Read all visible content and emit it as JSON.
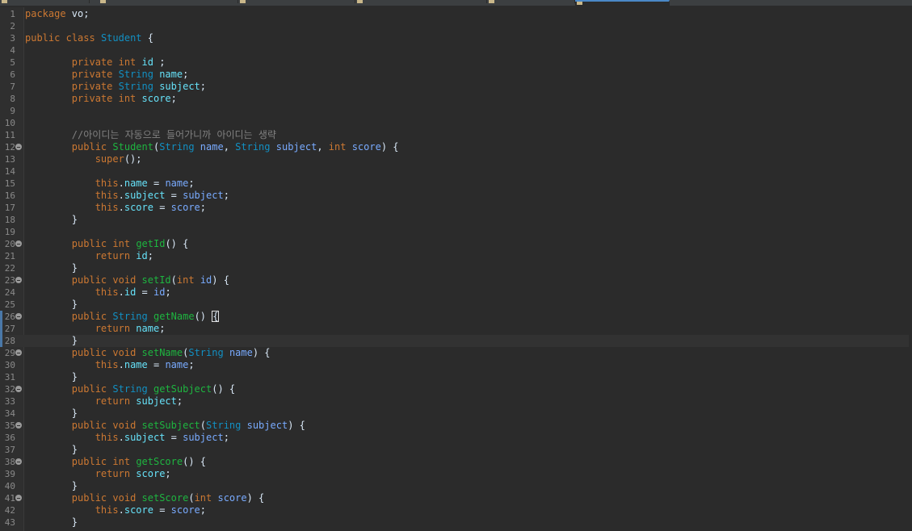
{
  "editor": {
    "current_line": 28,
    "lines": [
      {
        "no": "1",
        "fold": false,
        "tokens": [
          {
            "t": "package",
            "c": "kw"
          },
          {
            "t": " vo;",
            "c": "pl"
          }
        ]
      },
      {
        "no": "2",
        "fold": false,
        "tokens": []
      },
      {
        "no": "3",
        "fold": false,
        "tokens": [
          {
            "t": "public",
            "c": "kw"
          },
          {
            "t": " ",
            "c": "pl"
          },
          {
            "t": "class",
            "c": "kw"
          },
          {
            "t": " ",
            "c": "pl"
          },
          {
            "t": "Student",
            "c": "ty"
          },
          {
            "t": " {",
            "c": "pl"
          }
        ]
      },
      {
        "no": "4",
        "fold": false,
        "tokens": []
      },
      {
        "no": "5",
        "fold": false,
        "tokens": [
          {
            "t": "        ",
            "c": "pl"
          },
          {
            "t": "private",
            "c": "kw"
          },
          {
            "t": " ",
            "c": "pl"
          },
          {
            "t": "int",
            "c": "kw"
          },
          {
            "t": " ",
            "c": "pl"
          },
          {
            "t": "id",
            "c": "fld"
          },
          {
            "t": " ;",
            "c": "pl"
          }
        ]
      },
      {
        "no": "6",
        "fold": false,
        "tokens": [
          {
            "t": "        ",
            "c": "pl"
          },
          {
            "t": "private",
            "c": "kw"
          },
          {
            "t": " ",
            "c": "pl"
          },
          {
            "t": "String",
            "c": "ty"
          },
          {
            "t": " ",
            "c": "pl"
          },
          {
            "t": "name",
            "c": "fld"
          },
          {
            "t": ";",
            "c": "pl"
          }
        ]
      },
      {
        "no": "7",
        "fold": false,
        "tokens": [
          {
            "t": "        ",
            "c": "pl"
          },
          {
            "t": "private",
            "c": "kw"
          },
          {
            "t": " ",
            "c": "pl"
          },
          {
            "t": "String",
            "c": "ty"
          },
          {
            "t": " ",
            "c": "pl"
          },
          {
            "t": "subject",
            "c": "fld"
          },
          {
            "t": ";",
            "c": "pl"
          }
        ]
      },
      {
        "no": "8",
        "fold": false,
        "tokens": [
          {
            "t": "        ",
            "c": "pl"
          },
          {
            "t": "private",
            "c": "kw"
          },
          {
            "t": " ",
            "c": "pl"
          },
          {
            "t": "int",
            "c": "kw"
          },
          {
            "t": " ",
            "c": "pl"
          },
          {
            "t": "score",
            "c": "fld"
          },
          {
            "t": ";",
            "c": "pl"
          }
        ]
      },
      {
        "no": "9",
        "fold": false,
        "tokens": []
      },
      {
        "no": "10",
        "fold": false,
        "tokens": []
      },
      {
        "no": "11",
        "fold": false,
        "tokens": [
          {
            "t": "        ",
            "c": "pl"
          },
          {
            "t": "//아이디는 자동으로 들어가니까 아이디는 생략",
            "c": "cm"
          }
        ]
      },
      {
        "no": "12",
        "fold": true,
        "tokens": [
          {
            "t": "        ",
            "c": "pl"
          },
          {
            "t": "public",
            "c": "kw"
          },
          {
            "t": " ",
            "c": "pl"
          },
          {
            "t": "Student",
            "c": "fn"
          },
          {
            "t": "(",
            "c": "pl"
          },
          {
            "t": "String",
            "c": "ty"
          },
          {
            "t": " ",
            "c": "pl"
          },
          {
            "t": "name",
            "c": "var"
          },
          {
            "t": ", ",
            "c": "pl"
          },
          {
            "t": "String",
            "c": "ty"
          },
          {
            "t": " ",
            "c": "pl"
          },
          {
            "t": "subject",
            "c": "var"
          },
          {
            "t": ", ",
            "c": "pl"
          },
          {
            "t": "int",
            "c": "kw"
          },
          {
            "t": " ",
            "c": "pl"
          },
          {
            "t": "score",
            "c": "var"
          },
          {
            "t": ") {",
            "c": "pl"
          }
        ]
      },
      {
        "no": "13",
        "fold": false,
        "tokens": [
          {
            "t": "            ",
            "c": "pl"
          },
          {
            "t": "super",
            "c": "kw"
          },
          {
            "t": "();",
            "c": "pl"
          }
        ]
      },
      {
        "no": "14",
        "fold": false,
        "tokens": []
      },
      {
        "no": "15",
        "fold": false,
        "tokens": [
          {
            "t": "            ",
            "c": "pl"
          },
          {
            "t": "this",
            "c": "kw"
          },
          {
            "t": ".",
            "c": "pl"
          },
          {
            "t": "name",
            "c": "fld"
          },
          {
            "t": " = ",
            "c": "pl"
          },
          {
            "t": "name",
            "c": "var"
          },
          {
            "t": ";",
            "c": "pl"
          }
        ]
      },
      {
        "no": "16",
        "fold": false,
        "tokens": [
          {
            "t": "            ",
            "c": "pl"
          },
          {
            "t": "this",
            "c": "kw"
          },
          {
            "t": ".",
            "c": "pl"
          },
          {
            "t": "subject",
            "c": "fld"
          },
          {
            "t": " = ",
            "c": "pl"
          },
          {
            "t": "subject",
            "c": "var"
          },
          {
            "t": ";",
            "c": "pl"
          }
        ]
      },
      {
        "no": "17",
        "fold": false,
        "tokens": [
          {
            "t": "            ",
            "c": "pl"
          },
          {
            "t": "this",
            "c": "kw"
          },
          {
            "t": ".",
            "c": "pl"
          },
          {
            "t": "score",
            "c": "fld"
          },
          {
            "t": " = ",
            "c": "pl"
          },
          {
            "t": "score",
            "c": "var"
          },
          {
            "t": ";",
            "c": "pl"
          }
        ]
      },
      {
        "no": "18",
        "fold": false,
        "tokens": [
          {
            "t": "        }",
            "c": "pl"
          }
        ]
      },
      {
        "no": "19",
        "fold": false,
        "tokens": []
      },
      {
        "no": "20",
        "fold": true,
        "tokens": [
          {
            "t": "        ",
            "c": "pl"
          },
          {
            "t": "public",
            "c": "kw"
          },
          {
            "t": " ",
            "c": "pl"
          },
          {
            "t": "int",
            "c": "kw"
          },
          {
            "t": " ",
            "c": "pl"
          },
          {
            "t": "getId",
            "c": "fn"
          },
          {
            "t": "() {",
            "c": "pl"
          }
        ]
      },
      {
        "no": "21",
        "fold": false,
        "tokens": [
          {
            "t": "            ",
            "c": "pl"
          },
          {
            "t": "return",
            "c": "kw"
          },
          {
            "t": " ",
            "c": "pl"
          },
          {
            "t": "id",
            "c": "fld"
          },
          {
            "t": ";",
            "c": "pl"
          }
        ]
      },
      {
        "no": "22",
        "fold": false,
        "tokens": [
          {
            "t": "        }",
            "c": "pl"
          }
        ]
      },
      {
        "no": "23",
        "fold": true,
        "tokens": [
          {
            "t": "        ",
            "c": "pl"
          },
          {
            "t": "public",
            "c": "kw"
          },
          {
            "t": " ",
            "c": "pl"
          },
          {
            "t": "void",
            "c": "kw"
          },
          {
            "t": " ",
            "c": "pl"
          },
          {
            "t": "setId",
            "c": "fn"
          },
          {
            "t": "(",
            "c": "pl"
          },
          {
            "t": "int",
            "c": "kw"
          },
          {
            "t": " ",
            "c": "pl"
          },
          {
            "t": "id",
            "c": "var"
          },
          {
            "t": ") {",
            "c": "pl"
          }
        ]
      },
      {
        "no": "24",
        "fold": false,
        "tokens": [
          {
            "t": "            ",
            "c": "pl"
          },
          {
            "t": "this",
            "c": "kw"
          },
          {
            "t": ".",
            "c": "pl"
          },
          {
            "t": "id",
            "c": "fld"
          },
          {
            "t": " = ",
            "c": "pl"
          },
          {
            "t": "id",
            "c": "var"
          },
          {
            "t": ";",
            "c": "pl"
          }
        ]
      },
      {
        "no": "25",
        "fold": false,
        "tokens": [
          {
            "t": "        }",
            "c": "pl"
          }
        ]
      },
      {
        "no": "26",
        "fold": true,
        "tokens": [
          {
            "t": "        ",
            "c": "pl"
          },
          {
            "t": "public",
            "c": "kw"
          },
          {
            "t": " ",
            "c": "pl"
          },
          {
            "t": "String",
            "c": "ty"
          },
          {
            "t": " ",
            "c": "pl"
          },
          {
            "t": "getName",
            "c": "fn"
          },
          {
            "t": "() ",
            "c": "pl"
          },
          {
            "t": "{",
            "c": "caret"
          }
        ]
      },
      {
        "no": "27",
        "fold": false,
        "tokens": [
          {
            "t": "            ",
            "c": "pl"
          },
          {
            "t": "return",
            "c": "kw"
          },
          {
            "t": " ",
            "c": "pl"
          },
          {
            "t": "name",
            "c": "fld"
          },
          {
            "t": ";",
            "c": "pl"
          }
        ]
      },
      {
        "no": "28",
        "fold": false,
        "tokens": [
          {
            "t": "        }",
            "c": "pl"
          }
        ]
      },
      {
        "no": "29",
        "fold": true,
        "tokens": [
          {
            "t": "        ",
            "c": "pl"
          },
          {
            "t": "public",
            "c": "kw"
          },
          {
            "t": " ",
            "c": "pl"
          },
          {
            "t": "void",
            "c": "kw"
          },
          {
            "t": " ",
            "c": "pl"
          },
          {
            "t": "setName",
            "c": "fn"
          },
          {
            "t": "(",
            "c": "pl"
          },
          {
            "t": "String",
            "c": "ty"
          },
          {
            "t": " ",
            "c": "pl"
          },
          {
            "t": "name",
            "c": "var"
          },
          {
            "t": ") {",
            "c": "pl"
          }
        ]
      },
      {
        "no": "30",
        "fold": false,
        "tokens": [
          {
            "t": "            ",
            "c": "pl"
          },
          {
            "t": "this",
            "c": "kw"
          },
          {
            "t": ".",
            "c": "pl"
          },
          {
            "t": "name",
            "c": "fld"
          },
          {
            "t": " = ",
            "c": "pl"
          },
          {
            "t": "name",
            "c": "var"
          },
          {
            "t": ";",
            "c": "pl"
          }
        ]
      },
      {
        "no": "31",
        "fold": false,
        "tokens": [
          {
            "t": "        }",
            "c": "pl"
          }
        ]
      },
      {
        "no": "32",
        "fold": true,
        "tokens": [
          {
            "t": "        ",
            "c": "pl"
          },
          {
            "t": "public",
            "c": "kw"
          },
          {
            "t": " ",
            "c": "pl"
          },
          {
            "t": "String",
            "c": "ty"
          },
          {
            "t": " ",
            "c": "pl"
          },
          {
            "t": "getSubject",
            "c": "fn"
          },
          {
            "t": "() {",
            "c": "pl"
          }
        ]
      },
      {
        "no": "33",
        "fold": false,
        "tokens": [
          {
            "t": "            ",
            "c": "pl"
          },
          {
            "t": "return",
            "c": "kw"
          },
          {
            "t": " ",
            "c": "pl"
          },
          {
            "t": "subject",
            "c": "fld"
          },
          {
            "t": ";",
            "c": "pl"
          }
        ]
      },
      {
        "no": "34",
        "fold": false,
        "tokens": [
          {
            "t": "        }",
            "c": "pl"
          }
        ]
      },
      {
        "no": "35",
        "fold": true,
        "tokens": [
          {
            "t": "        ",
            "c": "pl"
          },
          {
            "t": "public",
            "c": "kw"
          },
          {
            "t": " ",
            "c": "pl"
          },
          {
            "t": "void",
            "c": "kw"
          },
          {
            "t": " ",
            "c": "pl"
          },
          {
            "t": "setSubject",
            "c": "fn"
          },
          {
            "t": "(",
            "c": "pl"
          },
          {
            "t": "String",
            "c": "ty"
          },
          {
            "t": " ",
            "c": "pl"
          },
          {
            "t": "subject",
            "c": "var"
          },
          {
            "t": ") {",
            "c": "pl"
          }
        ]
      },
      {
        "no": "36",
        "fold": false,
        "tokens": [
          {
            "t": "            ",
            "c": "pl"
          },
          {
            "t": "this",
            "c": "kw"
          },
          {
            "t": ".",
            "c": "pl"
          },
          {
            "t": "subject",
            "c": "fld"
          },
          {
            "t": " = ",
            "c": "pl"
          },
          {
            "t": "subject",
            "c": "var"
          },
          {
            "t": ";",
            "c": "pl"
          }
        ]
      },
      {
        "no": "37",
        "fold": false,
        "tokens": [
          {
            "t": "        }",
            "c": "pl"
          }
        ]
      },
      {
        "no": "38",
        "fold": true,
        "tokens": [
          {
            "t": "        ",
            "c": "pl"
          },
          {
            "t": "public",
            "c": "kw"
          },
          {
            "t": " ",
            "c": "pl"
          },
          {
            "t": "int",
            "c": "kw"
          },
          {
            "t": " ",
            "c": "pl"
          },
          {
            "t": "getScore",
            "c": "fn"
          },
          {
            "t": "() {",
            "c": "pl"
          }
        ]
      },
      {
        "no": "39",
        "fold": false,
        "tokens": [
          {
            "t": "            ",
            "c": "pl"
          },
          {
            "t": "return",
            "c": "kw"
          },
          {
            "t": " ",
            "c": "pl"
          },
          {
            "t": "score",
            "c": "fld"
          },
          {
            "t": ";",
            "c": "pl"
          }
        ]
      },
      {
        "no": "40",
        "fold": false,
        "tokens": [
          {
            "t": "        }",
            "c": "pl"
          }
        ]
      },
      {
        "no": "41",
        "fold": true,
        "tokens": [
          {
            "t": "        ",
            "c": "pl"
          },
          {
            "t": "public",
            "c": "kw"
          },
          {
            "t": " ",
            "c": "pl"
          },
          {
            "t": "void",
            "c": "kw"
          },
          {
            "t": " ",
            "c": "pl"
          },
          {
            "t": "setScore",
            "c": "fn"
          },
          {
            "t": "(",
            "c": "pl"
          },
          {
            "t": "int",
            "c": "kw"
          },
          {
            "t": " ",
            "c": "pl"
          },
          {
            "t": "score",
            "c": "var"
          },
          {
            "t": ") {",
            "c": "pl"
          }
        ]
      },
      {
        "no": "42",
        "fold": false,
        "tokens": [
          {
            "t": "            ",
            "c": "pl"
          },
          {
            "t": "this",
            "c": "kw"
          },
          {
            "t": ".",
            "c": "pl"
          },
          {
            "t": "score",
            "c": "fld"
          },
          {
            "t": " = ",
            "c": "pl"
          },
          {
            "t": "score",
            "c": "var"
          },
          {
            "t": ";",
            "c": "pl"
          }
        ]
      },
      {
        "no": "43",
        "fold": false,
        "tokens": [
          {
            "t": "        }",
            "c": "pl"
          }
        ]
      }
    ]
  }
}
